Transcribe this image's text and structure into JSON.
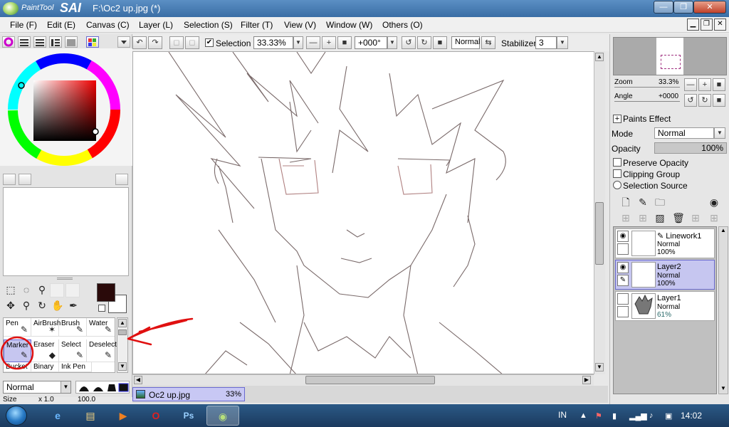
{
  "app": {
    "brand_small": "PaintTool",
    "brand_large": "SAI",
    "title": "F:\\Oc2 up.jpg (*)"
  },
  "window_buttons": {
    "minimize": "—",
    "restore": "❐",
    "close": "✕"
  },
  "menu": [
    {
      "label": "File (F)"
    },
    {
      "label": "Edit (E)"
    },
    {
      "label": "Canvas (C)"
    },
    {
      "label": "Layer (L)"
    },
    {
      "label": "Selection (S)"
    },
    {
      "label": "Filter (T)"
    },
    {
      "label": "View (V)"
    },
    {
      "label": "Window (W)"
    },
    {
      "label": "Others (O)"
    }
  ],
  "toolbar": {
    "selection_label": "Selection",
    "zoom": "33.33%",
    "angle": "+000°",
    "blend": "Normal",
    "stabilizer_label": "Stabilizer",
    "stabilizer_value": "3"
  },
  "tools": [
    {
      "label": "Pen",
      "icon": "pen-icon",
      "glyph": "✎",
      "selected": false
    },
    {
      "label": "AirBrush",
      "icon": "airbrush-icon",
      "glyph": "✶",
      "selected": false
    },
    {
      "label": "Brush",
      "icon": "brush-icon",
      "glyph": "✎",
      "selected": false
    },
    {
      "label": "Water",
      "icon": "water-icon",
      "glyph": "✎",
      "selected": false
    },
    {
      "label": "Marker",
      "icon": "marker-icon",
      "glyph": "✎",
      "selected": true
    },
    {
      "label": "Eraser",
      "icon": "eraser-icon",
      "glyph": "◆",
      "selected": false
    },
    {
      "label": "Select",
      "icon": "select-icon",
      "glyph": "✎",
      "selected": false
    },
    {
      "label": "Deselect",
      "icon": "deselect-icon",
      "glyph": "✎",
      "selected": false
    },
    {
      "label": "Bucket",
      "icon": "bucket-icon",
      "glyph": "",
      "selected": false
    },
    {
      "label": "Binary",
      "icon": "binary-icon",
      "glyph": "",
      "selected": false
    },
    {
      "label": "Ink Pen",
      "icon": "ink-pen-icon",
      "glyph": "",
      "selected": false
    }
  ],
  "left": {
    "blend_mode": "Normal"
  },
  "colors": {
    "primary": "#2a0a0a",
    "secondary": "#ffffff",
    "accent_selected": "#c6c6f0",
    "annotation_red": "#e01010"
  },
  "right": {
    "zoom_label": "Zoom",
    "zoom_value": "33.3%",
    "angle_label": "Angle",
    "angle_value": "+0000",
    "paints_effect": "Paints Effect",
    "mode_label": "Mode",
    "mode_value": "Normal",
    "opacity_label": "Opacity",
    "opacity_value": "100%",
    "preserve_opacity": "Preserve Opacity",
    "clipping_group": "Clipping Group",
    "selection_source": "Selection Source"
  },
  "layers": [
    {
      "name": "Linework1",
      "mode": "Normal",
      "opacity": "100%",
      "selected": false
    },
    {
      "name": "Layer2",
      "mode": "Normal",
      "opacity": "100%",
      "selected": true
    },
    {
      "name": "Layer1",
      "mode": "Normal",
      "opacity": "61%",
      "selected": false
    }
  ],
  "document_tab": {
    "name": "Oc2 up.jpg",
    "zoom": "33%"
  },
  "taskbar": {
    "lang": "IN",
    "time": "14:02"
  }
}
